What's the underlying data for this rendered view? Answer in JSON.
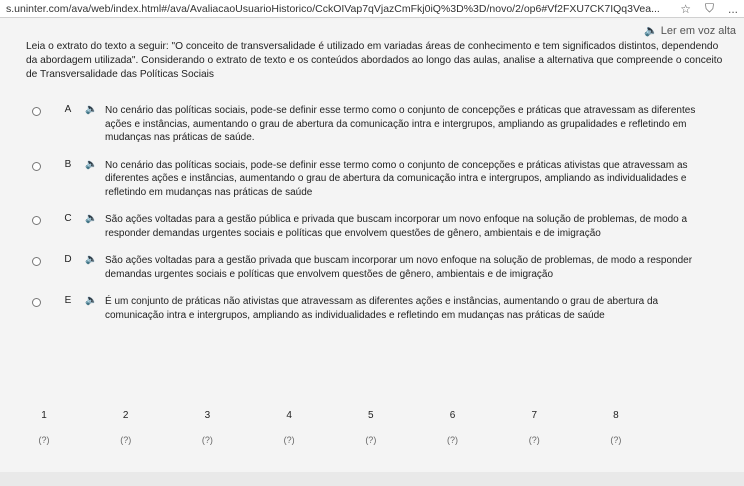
{
  "browser": {
    "url": "s.uninter.com/ava/web/index.html#/ava/AvaliacaoUsuarioHistorico/CckOIVap7qVjazCmFkj0iQ%3D%3D/novo/2/op6#Vf2FXU7CK7IQq3Vea...",
    "star_icon": "star-icon",
    "menu_label": "..."
  },
  "tts": {
    "label": "Ler em voz alta",
    "icon": "speaker-icon"
  },
  "question": {
    "text": "Leia o extrato do texto a seguir: \"O conceito de transversalidade é utilizado em variadas áreas de conhecimento e tem significados distintos, dependendo da abordagem utilizada\". Considerando o extrato de texto e os conteúdos abordados ao longo das aulas, analise a alternativa que compreende o conceito de Transversalidade das Políticas Sociais"
  },
  "options": [
    {
      "letter": "A",
      "text": "No cenário das políticas sociais, pode-se definir esse termo como o conjunto de concepções e práticas que atravessam as diferentes ações e instâncias, aumentando o grau de abertura da comunicação intra e intergrupos, ampliando as grupalidades e refletindo em mudanças nas práticas de saúde."
    },
    {
      "letter": "B",
      "text": "No cenário das políticas sociais, pode-se definir esse termo como o conjunto de concepções e práticas ativistas que atravessam as diferentes ações e instâncias, aumentando o grau de abertura da comunicação intra e intergrupos, ampliando as individualidades e refletindo em mudanças nas práticas de saúde"
    },
    {
      "letter": "C",
      "text": "São ações voltadas para a gestão pública e privada que buscam incorporar um novo enfoque na solução de problemas, de modo a responder demandas urgentes sociais e políticas que envolvem questões de gênero, ambientais e de imigração"
    },
    {
      "letter": "D",
      "text": "São ações voltadas para a gestão privada que buscam incorporar um novo enfoque na solução de problemas, de modo a responder demandas urgentes sociais e políticas que envolvem questões de gênero, ambientais e de imigração"
    },
    {
      "letter": "E",
      "text": "É um conjunto de práticas não ativistas que atravessam as diferentes ações e instâncias, aumentando o grau de abertura da comunicação intra e intergrupos, ampliando as individualidades e refletindo em mudanças nas práticas de saúde"
    }
  ],
  "question_nav": {
    "numbers": [
      "1",
      "2",
      "3",
      "4",
      "5",
      "6",
      "7",
      "8"
    ],
    "marks": [
      "(?)",
      "(?)",
      "(?)",
      "(?)",
      "(?)",
      "(?)",
      "(?)",
      "(?)"
    ]
  }
}
